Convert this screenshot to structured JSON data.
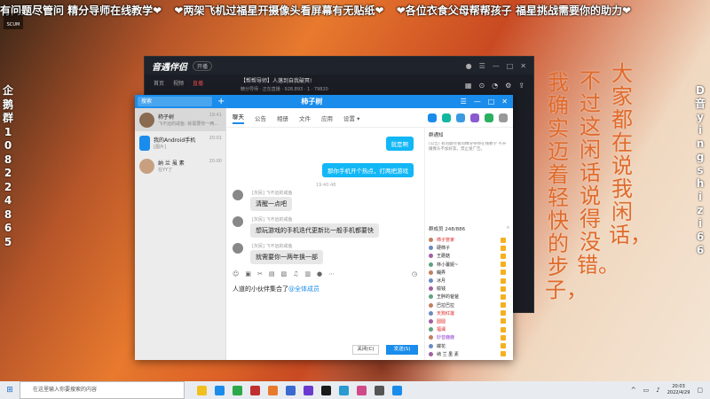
{
  "marquee": [
    "有问题尽管问 精分导师在线教学❤",
    "❤两架飞机过福星开摄像头看屏幕有无贴纸❤",
    "❤各位衣食父母帮帮孩子 福星挑战需要你的助力❤"
  ],
  "badge_label": "SCUM",
  "left_column": [
    "企",
    "鹅",
    "群",
    "1",
    "0",
    "8",
    "2",
    "2",
    "4",
    "8",
    "6",
    "5"
  ],
  "right_column": [
    "D",
    "音",
    "y",
    "i",
    "n",
    "g",
    "s",
    "h",
    "i",
    "z",
    "i",
    "6",
    "6"
  ],
  "poem": {
    "col1": "大家都在说我闲话，",
    "col2": "不过这闲话说得没错。",
    "col3": "我确实迈着轻快的步子，"
  },
  "back_window": {
    "logo": "音遇伴侣",
    "chip": "开播",
    "tabs": [
      "首页",
      "视频",
      "直播"
    ],
    "info": "【帮帮导师】人落到自我破冥!",
    "info2": "精分导师 · 正在直播 · 928,893 · 1 · 79820"
  },
  "chat_window": {
    "search_placeholder": "搜索",
    "title": "柿子树",
    "conversations": [
      {
        "name": "柿子树",
        "preview": "飞不远的咸鱼: 就需要你一两...",
        "time": "19:41"
      },
      {
        "name": "我的Android手机",
        "preview": "[图片]",
        "time": "20:01"
      },
      {
        "name": "纳 兰 虽 素",
        "preview": "在YY了",
        "time": "20:00"
      }
    ],
    "tabs": [
      "聊天",
      "公告",
      "相册",
      "文件",
      "应用",
      "设置 ▾"
    ],
    "messages_out": [
      "就是啊",
      "那你手机开个热点，打两把游戏"
    ],
    "time_sep": "19:40:48",
    "messages_in": [
      {
        "name": "[灰民] 飞不远的咸鱼",
        "text": "清醒一点吧"
      },
      {
        "name": "[灰民] 飞不远的咸鱼",
        "text": "想玩游戏的手机迭代更新比一般手机都要快"
      },
      {
        "name": "[灰民] 飞不远的咸鱼",
        "text": "就需要你一两年换一部"
      }
    ],
    "input_text": "人道的小伙伴集合了",
    "input_mention": "@全体成员",
    "btn_close": "关闭(C)",
    "btn_send": "发送(S)",
    "right_panel": {
      "notice_title": "群通知",
      "notice_text": "[公告] 有问题尽管问精分导师在线教学 不开摄像头不加好友。禁止发广告。",
      "members_title": "群成员 248/886",
      "members": [
        {
          "name": "柿子管家",
          "style": "red"
        },
        {
          "name": "硬柿子",
          "style": ""
        },
        {
          "name": "王蘑菇",
          "style": ""
        },
        {
          "name": "林小薯妮~",
          "style": ""
        },
        {
          "name": "糊弄",
          "style": ""
        },
        {
          "name": "冰月",
          "style": ""
        },
        {
          "name": "榆钱",
          "style": ""
        },
        {
          "name": "王胖的爸爸",
          "style": ""
        },
        {
          "name": "巴拉巴拉",
          "style": ""
        },
        {
          "name": "天狗红莲",
          "style": "red"
        },
        {
          "name": "圆圆",
          "style": "red"
        },
        {
          "name": "福澜",
          "style": "red"
        },
        {
          "name": "妙音鹿鹿",
          "style": "purple"
        },
        {
          "name": "蝶花",
          "style": ""
        },
        {
          "name": "纳 兰 虽 素",
          "style": ""
        }
      ]
    }
  },
  "taskbar": {
    "search_placeholder": "在这里输入你要搜索的内容",
    "time": "20:03",
    "date": "2022/4/29",
    "app_colors": [
      "#f0c020",
      "#1a8ceb",
      "#2ba84a",
      "#c03030",
      "#e87a2e",
      "#3a6ad0",
      "#6a3ad0",
      "#1a1a1a",
      "#2a9ad0",
      "#d04a8a",
      "#555555",
      "#1a8ceb"
    ]
  }
}
